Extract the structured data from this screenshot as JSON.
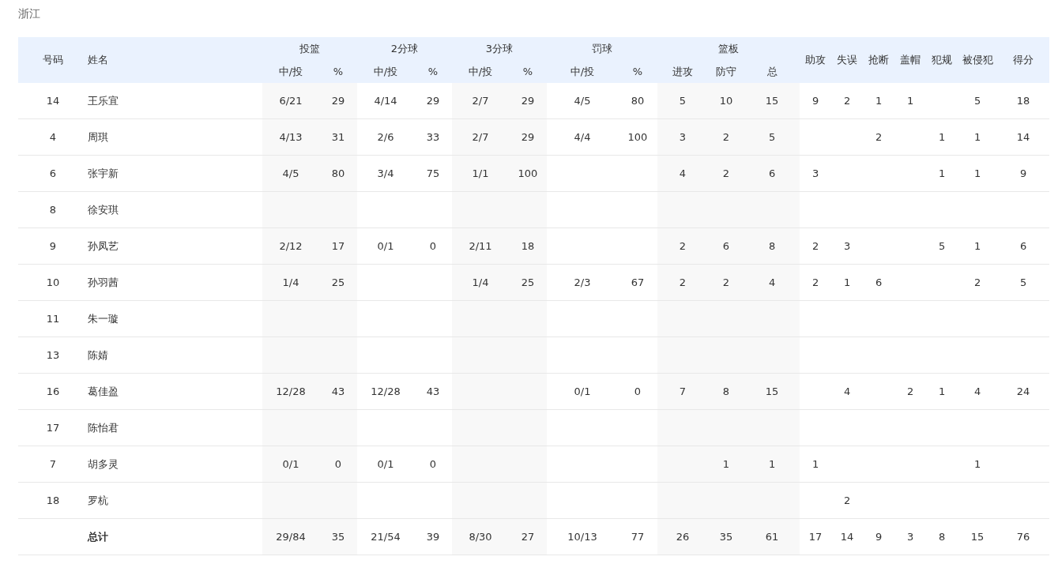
{
  "team": "浙江",
  "table": {
    "number_header": "号码",
    "name_header": "姓名",
    "groups": [
      {
        "label": "投篮",
        "sub": [
          "中/投",
          "%"
        ]
      },
      {
        "label": "2分球",
        "sub": [
          "中/投",
          "%"
        ]
      },
      {
        "label": "3分球",
        "sub": [
          "中/投",
          "%"
        ]
      },
      {
        "label": "罚球",
        "sub": [
          "中/投",
          "%"
        ]
      },
      {
        "label": "篮板",
        "sub": [
          "进攻",
          "防守",
          "总"
        ]
      }
    ],
    "singles": [
      "助攻",
      "失误",
      "抢断",
      "盖帽",
      "犯规",
      "被侵犯",
      "得分"
    ],
    "rows": [
      {
        "number": "14",
        "name": "王乐宜",
        "stats": {
          "fg": "6/21",
          "fg_pct": "29",
          "two": "4/14",
          "two_pct": "29",
          "three": "2/7",
          "three_pct": "29",
          "ft": "4/5",
          "ft_pct": "80",
          "off_reb": "5",
          "def_reb": "10",
          "total_reb": "15",
          "assists": "9",
          "turnovers": "2",
          "steals": "1",
          "blocks": "1",
          "fouls_drawn": "5",
          "points": "18"
        }
      },
      {
        "number": "4",
        "name": "周琪",
        "stats": {
          "fg": "4/13",
          "fg_pct": "31",
          "two": "2/6",
          "two_pct": "33",
          "three": "2/7",
          "three_pct": "29",
          "ft": "4/4",
          "ft_pct": "100",
          "off_reb": "3",
          "def_reb": "2",
          "total_reb": "5",
          "steals": "2",
          "fouls": "1",
          "fouls_drawn": "1",
          "points": "14"
        }
      },
      {
        "number": "6",
        "name": "张宇新",
        "stats": {
          "fg": "4/5",
          "fg_pct": "80",
          "two": "3/4",
          "two_pct": "75",
          "three": "1/1",
          "three_pct": "100",
          "off_reb": "4",
          "def_reb": "2",
          "total_reb": "6",
          "assists": "3",
          "fouls": "1",
          "fouls_drawn": "1",
          "points": "9"
        }
      },
      {
        "number": "8",
        "name": "徐安琪"
      },
      {
        "number": "9",
        "name": "孙凤艺",
        "stats": {
          "fg": "2/12",
          "fg_pct": "17",
          "two": "0/1",
          "two_pct": "0",
          "three": "2/11",
          "three_pct": "18",
          "off_reb": "2",
          "def_reb": "6",
          "total_reb": "8",
          "assists": "2",
          "turnovers": "3",
          "fouls": "5",
          "fouls_drawn": "1",
          "points": "6"
        }
      },
      {
        "number": "10",
        "name": "孙羽茜",
        "stats": {
          "fg": "1/4",
          "fg_pct": "25",
          "three": "1/4",
          "three_pct": "25",
          "ft": "2/3",
          "ft_pct": "67",
          "off_reb": "2",
          "def_reb": "2",
          "total_reb": "4",
          "assists": "2",
          "turnovers": "1",
          "steals": "6",
          "fouls_drawn": "2",
          "points": "5"
        }
      },
      {
        "number": "11",
        "name": "朱一璇"
      },
      {
        "number": "13",
        "name": "陈婧"
      },
      {
        "number": "16",
        "name": "葛佳盈",
        "stats": {
          "fg": "12/28",
          "fg_pct": "43",
          "two": "12/28",
          "two_pct": "43",
          "ft": "0/1",
          "ft_pct": "0",
          "off_reb": "7",
          "def_reb": "8",
          "total_reb": "15",
          "turnovers": "4",
          "blocks": "2",
          "fouls": "1",
          "fouls_drawn": "4",
          "points": "24"
        }
      },
      {
        "number": "17",
        "name": "陈怡君"
      },
      {
        "number": "7",
        "name": "胡多灵",
        "stats": {
          "fg": "0/1",
          "fg_pct": "0",
          "two": "0/1",
          "two_pct": "0",
          "def_reb": "1",
          "total_reb": "1",
          "assists": "1",
          "fouls_drawn": "1"
        }
      },
      {
        "number": "18",
        "name": "罗杭",
        "stats": {
          "turnovers": "2"
        }
      }
    ],
    "total": {
      "label": "总计",
      "stats": {
        "fg": "29/84",
        "fg_pct": "35",
        "two": "21/54",
        "two_pct": "39",
        "three": "8/30",
        "three_pct": "27",
        "ft": "10/13",
        "ft_pct": "77",
        "off_reb": "26",
        "def_reb": "35",
        "total_reb": "61",
        "assists": "17",
        "turnovers": "14",
        "steals": "9",
        "blocks": "3",
        "fouls": "8",
        "fouls_drawn": "15",
        "points": "76"
      }
    }
  }
}
